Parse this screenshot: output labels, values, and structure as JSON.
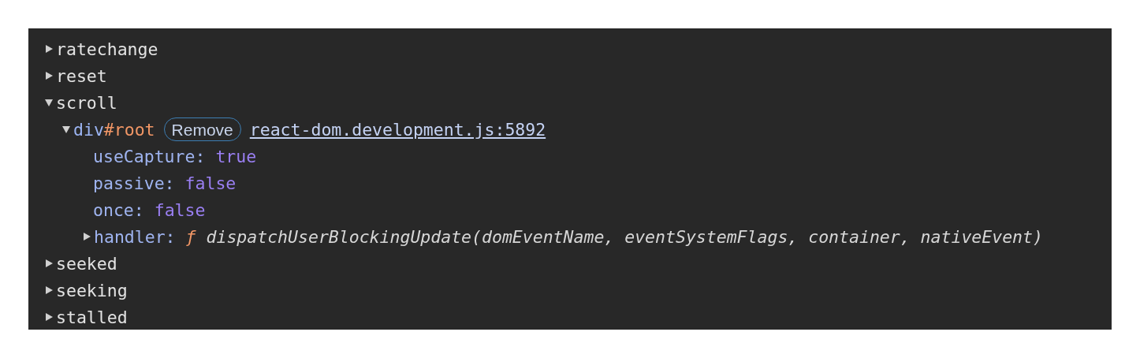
{
  "events": [
    {
      "name": "ratechange",
      "expanded": false
    },
    {
      "name": "reset",
      "expanded": false
    },
    {
      "name": "scroll",
      "expanded": true,
      "listeners": [
        {
          "node": "div",
          "id": "#root",
          "expanded": true,
          "button": "Remove",
          "link": "react-dom.development.js:5892",
          "properties": [
            {
              "key": "useCapture:",
              "value": "true",
              "kind": "boolean"
            },
            {
              "key": "passive:",
              "value": "false",
              "kind": "boolean"
            },
            {
              "key": "once:",
              "value": "false",
              "kind": "boolean"
            }
          ],
          "handler": {
            "key": "handler:",
            "expanded": false,
            "f": "ƒ",
            "signature": "dispatchUserBlockingUpdate(domEventName, eventSystemFlags, container, nativeEvent)"
          }
        }
      ]
    },
    {
      "name": "seeked",
      "expanded": false
    },
    {
      "name": "seeking",
      "expanded": false
    },
    {
      "name": "stalled",
      "expanded": false
    }
  ]
}
